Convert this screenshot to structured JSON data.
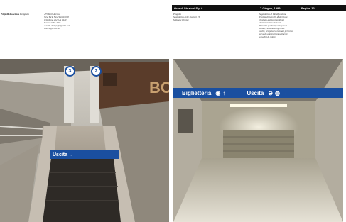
{
  "header": {
    "firm_name": "Vignelli Associates",
    "firm_role": "Designers",
    "address": "475 Tenth Avenue\nNew York, New York 10018\nTelephone 212 244 1919\nFax 212 967 4865\ne-mail: design@vignelli.com\nwww.vignelli.com",
    "project_label": "Progetto",
    "project_desc": "Segnaletica delle Stazioni FS\nMilano e Firenze",
    "client": "Grandi Stazioni S.p.A.",
    "date": "7 Giugno, 1999",
    "page": "Pagina 12",
    "notes": "Segnaletica di Identificazione\nEsempi di pannelli di direzione\nrinviano a sistemi applicati\ndirettamente sulle pareti.\nPannelli quadrati, collegati ai\nbinari, rinviano a ingressi e\nuscite, progettati e manuali percorso\nsecondo applicati annualmente,\na pallini di colore."
  },
  "photo_left": {
    "badge_a": "3",
    "badge_b": "2",
    "exit_label": "Uscita",
    "exit_arrow": "←",
    "wall_text": "BC"
  },
  "photo_right": {
    "ticket_label": "Biglietteria",
    "ticket_arrow": "↑",
    "exit_label": "Uscita",
    "exit_arrow": "→"
  },
  "colors": {
    "sign_blue": "#1a4fa0",
    "band_black": "#111111"
  }
}
